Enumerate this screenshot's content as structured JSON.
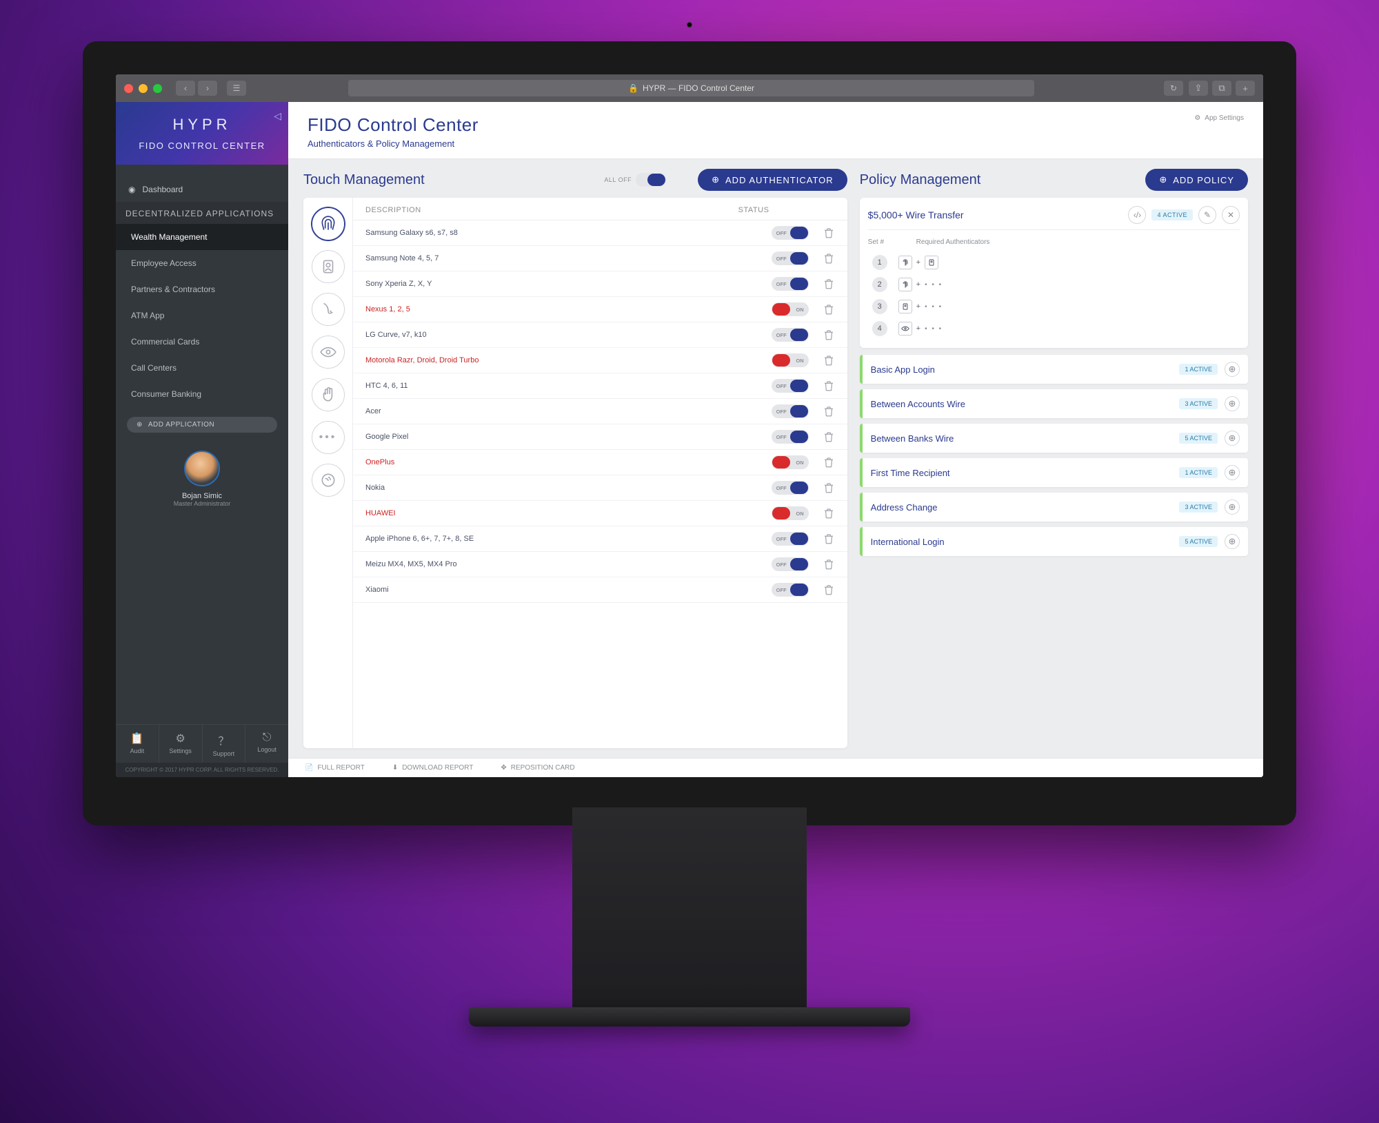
{
  "browser": {
    "url_label": "HYPR — FIDO Control Center"
  },
  "sidebar": {
    "logo": "HYPR",
    "title": "FIDO CONTROL CENTER",
    "dashboard": "Dashboard",
    "section": "DECENTRALIZED APPLICATIONS",
    "apps": [
      "Wealth Management",
      "Employee Access",
      "Partners & Contractors",
      "ATM App",
      "Commercial Cards",
      "Call Centers",
      "Consumer Banking"
    ],
    "add_app": "ADD APPLICATION",
    "profile": {
      "name": "Bojan Simic",
      "role": "Master Administrator"
    },
    "footer": {
      "audit": "Audit",
      "settings": "Settings",
      "support": "Support",
      "logout": "Logout"
    },
    "copyright": "COPYRIGHT © 2017 HYPR CORP. ALL RIGHTS RESERVED."
  },
  "header": {
    "title": "FIDO Control Center",
    "subtitle": "Authenticators & Policy Management",
    "settings": "App Settings"
  },
  "touch": {
    "title": "Touch Management",
    "all_off": "ALL OFF",
    "add_btn": "ADD AUTHENTICATOR",
    "columns": {
      "desc": "DESCRIPTION",
      "status": "STATUS"
    },
    "devices": [
      {
        "name": "Samsung Galaxy s6, s7, s8",
        "state": "off",
        "err": false
      },
      {
        "name": "Samsung Note 4, 5, 7",
        "state": "off",
        "err": false
      },
      {
        "name": "Sony Xperia Z, X, Y",
        "state": "off",
        "err": false
      },
      {
        "name": "Nexus 1, 2, 5",
        "state": "on",
        "err": true
      },
      {
        "name": "LG Curve, v7, k10",
        "state": "off",
        "err": false
      },
      {
        "name": "Motorola Razr, Droid, Droid Turbo",
        "state": "on",
        "err": true
      },
      {
        "name": "HTC 4, 6, 11",
        "state": "off",
        "err": false
      },
      {
        "name": "Acer",
        "state": "off",
        "err": false
      },
      {
        "name": "Google Pixel",
        "state": "off",
        "err": false
      },
      {
        "name": "OnePlus",
        "state": "on",
        "err": true
      },
      {
        "name": "Nokia",
        "state": "off",
        "err": false
      },
      {
        "name": "HUAWEI",
        "state": "on",
        "err": true
      },
      {
        "name": "Apple iPhone 6, 6+, 7, 7+, 8, SE",
        "state": "off",
        "err": false
      },
      {
        "name": "Meizu MX4, MX5, MX4 Pro",
        "state": "off",
        "err": false
      },
      {
        "name": "Xiaomi",
        "state": "off",
        "err": false
      }
    ]
  },
  "policy": {
    "title": "Policy Management",
    "add_btn": "ADD POLICY",
    "expanded": {
      "name": "$5,000+ Wire Transfer",
      "badge": "4 ACTIVE",
      "set_col": "Set #",
      "auth_col": "Required Authenticators",
      "sets": [
        {
          "n": "1",
          "type": "fp_face"
        },
        {
          "n": "2",
          "type": "fp_dots"
        },
        {
          "n": "3",
          "type": "face_dots"
        },
        {
          "n": "4",
          "type": "eye_dots"
        }
      ]
    },
    "list": [
      {
        "name": "Basic App Login",
        "badge": "1 ACTIVE"
      },
      {
        "name": "Between Accounts Wire",
        "badge": "3 ACTIVE"
      },
      {
        "name": "Between Banks Wire",
        "badge": "5 ACTIVE"
      },
      {
        "name": "First Time Recipient",
        "badge": "1 ACTIVE"
      },
      {
        "name": "Address Change",
        "badge": "3 ACTIVE"
      },
      {
        "name": "International Login",
        "badge": "5 ACTIVE"
      }
    ]
  },
  "footer": {
    "full_report": "FULL REPORT",
    "download": "DOWNLOAD REPORT",
    "reposition": "REPOSITION CARD"
  }
}
